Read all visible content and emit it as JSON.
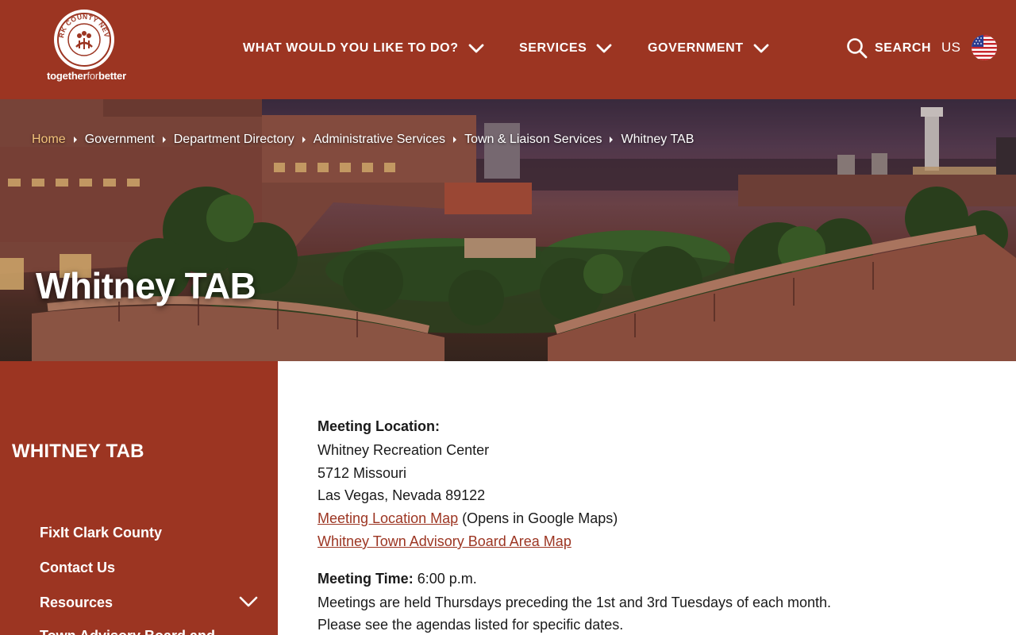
{
  "colors": {
    "brand": "#9c3522",
    "breadcrumb_home": "#f2c27a",
    "link": "#9c3522"
  },
  "header": {
    "logo": {
      "badge_text": "CLARK COUNTY NEVADA",
      "tag_bold_1": "together",
      "tag_light": "for",
      "tag_bold_2": "better"
    },
    "nav": [
      {
        "label": "WHAT WOULD YOU LIKE TO DO?",
        "icon": "chevron-down-icon"
      },
      {
        "label": "SERVICES",
        "icon": "chevron-down-icon"
      },
      {
        "label": "GOVERNMENT",
        "icon": "chevron-down-icon"
      }
    ],
    "search_label": "SEARCH",
    "search_icon": "search-icon",
    "language_label": "US",
    "flag_icon": "us-flag-icon"
  },
  "breadcrumb": [
    "Home",
    "Government",
    "Department Directory",
    "Administrative Services",
    "Town & Liaison Services",
    "Whitney TAB"
  ],
  "hero": {
    "title": "Whitney TAB"
  },
  "sidebar": {
    "title": "WHITNEY TAB",
    "items": [
      {
        "label": "FixIt Clark County"
      },
      {
        "label": "Contact Us"
      },
      {
        "label": "Resources",
        "icon": "chevron-down-icon"
      },
      {
        "label": "Town Advisory Board and"
      }
    ]
  },
  "content": {
    "location_heading": "Meeting Location:",
    "location_name": "Whitney Recreation Center",
    "street": "5712 Missouri",
    "city": "Las Vegas, Nevada 89122",
    "map_link": "Meeting Location Map",
    "map_note": "(Opens in Google Maps)",
    "area_map_link": "Whitney Town Advisory Board Area Map",
    "time_heading": "Meeting Time:",
    "time_value": "6:00 p.m.",
    "schedule_line_1": "Meetings are held Thursdays preceding the 1st and 3rd Tuesdays of each month.",
    "schedule_line_2": "Please see the agendas listed for specific dates."
  }
}
